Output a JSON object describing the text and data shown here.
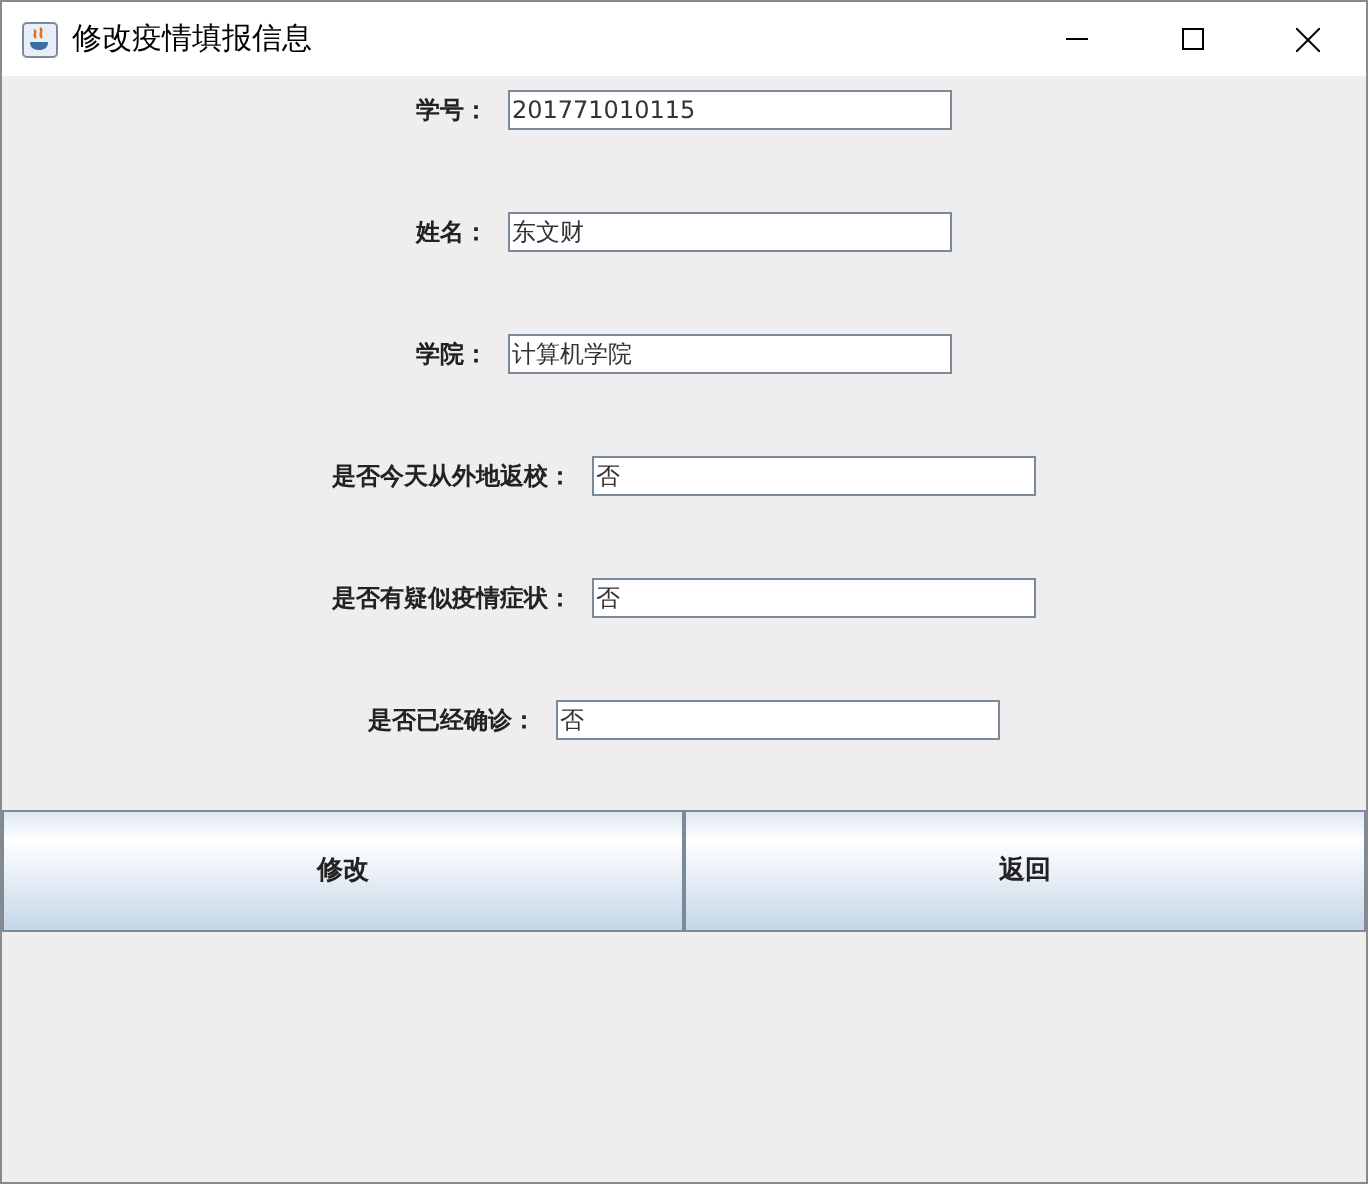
{
  "window": {
    "title": "修改疫情填报信息"
  },
  "fields": [
    {
      "label": "学号：",
      "value": "201771010115"
    },
    {
      "label": "姓名：",
      "value": "东文财"
    },
    {
      "label": "学院：",
      "value": "计算机学院"
    },
    {
      "label": "是否今天从外地返校：",
      "value": "否"
    },
    {
      "label": "是否有疑似疫情症状：",
      "value": "否"
    },
    {
      "label": "是否已经确诊：",
      "value": "否"
    }
  ],
  "buttons": [
    "修改",
    "返回"
  ]
}
